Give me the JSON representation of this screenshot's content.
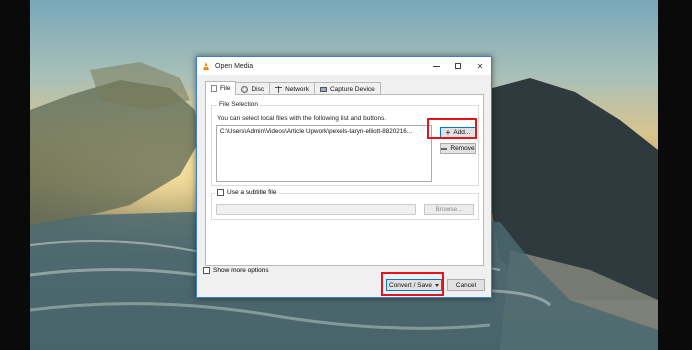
{
  "dialog": {
    "title": "Open Media",
    "window_controls": [
      "minimize-icon",
      "maximize-icon",
      "close-icon"
    ]
  },
  "tabs": [
    {
      "label": "File",
      "icon": "file-icon",
      "active": true
    },
    {
      "label": "Disc",
      "icon": "disc-icon",
      "active": false
    },
    {
      "label": "Network",
      "icon": "network-icon",
      "active": false
    },
    {
      "label": "Capture Device",
      "icon": "capture-device-icon",
      "active": false
    }
  ],
  "file_selection": {
    "legend": "File Selection",
    "description": "You can select local files with the following list and buttons.",
    "files": [
      "C:\\Users\\Admin\\Videos\\Article Upwork\\pexels-taryn-elliott-8820216..."
    ],
    "add_label": "Add...",
    "remove_label": "Remove"
  },
  "subtitle": {
    "label": "Use a subtitle file",
    "checked": false,
    "path_value": "",
    "browse_label": "Browse..."
  },
  "options": {
    "show_more_label": "Show more options",
    "show_more_checked": false
  },
  "actions": {
    "convert_label": "Convert / Save",
    "cancel_label": "Cancel"
  },
  "colors": {
    "highlight": "#e4141b",
    "focus_border": "#0078d7",
    "vlc_orange": "#f08a00"
  }
}
